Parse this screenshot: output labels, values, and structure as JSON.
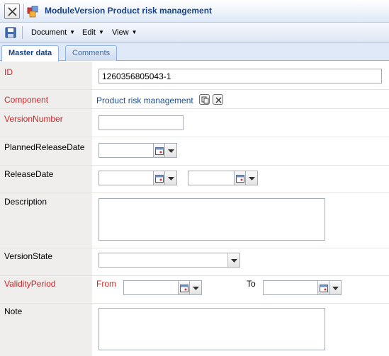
{
  "window": {
    "title": "ModuleVersion Product risk management"
  },
  "toolbar": {
    "menus": [
      {
        "label": "Document"
      },
      {
        "label": "Edit"
      },
      {
        "label": "View"
      }
    ]
  },
  "tabs": [
    {
      "label": "Master data",
      "active": true
    },
    {
      "label": "Comments",
      "active": false
    }
  ],
  "form": {
    "id": {
      "label": "ID",
      "value": "1260356805043-1",
      "required": true
    },
    "component": {
      "label": "Component",
      "value": "Product risk management",
      "required": true
    },
    "version_number": {
      "label": "VersionNumber",
      "value": "",
      "required": true
    },
    "planned_release_date": {
      "label": "PlannedReleaseDate",
      "value": ""
    },
    "release_date": {
      "label": "ReleaseDate",
      "date": "",
      "time": ""
    },
    "description": {
      "label": "Description",
      "value": ""
    },
    "version_state": {
      "label": "VersionState",
      "selected": ""
    },
    "validity_period": {
      "label": "ValidityPeriod",
      "from_label": "From",
      "to_label": "To",
      "from": "",
      "to": "",
      "required": true
    },
    "note": {
      "label": "Note",
      "value": ""
    }
  },
  "colors": {
    "required_label": "#c62929",
    "title_text": "#15428b",
    "link": "#1d4f91",
    "label_column": "#efeeec"
  }
}
